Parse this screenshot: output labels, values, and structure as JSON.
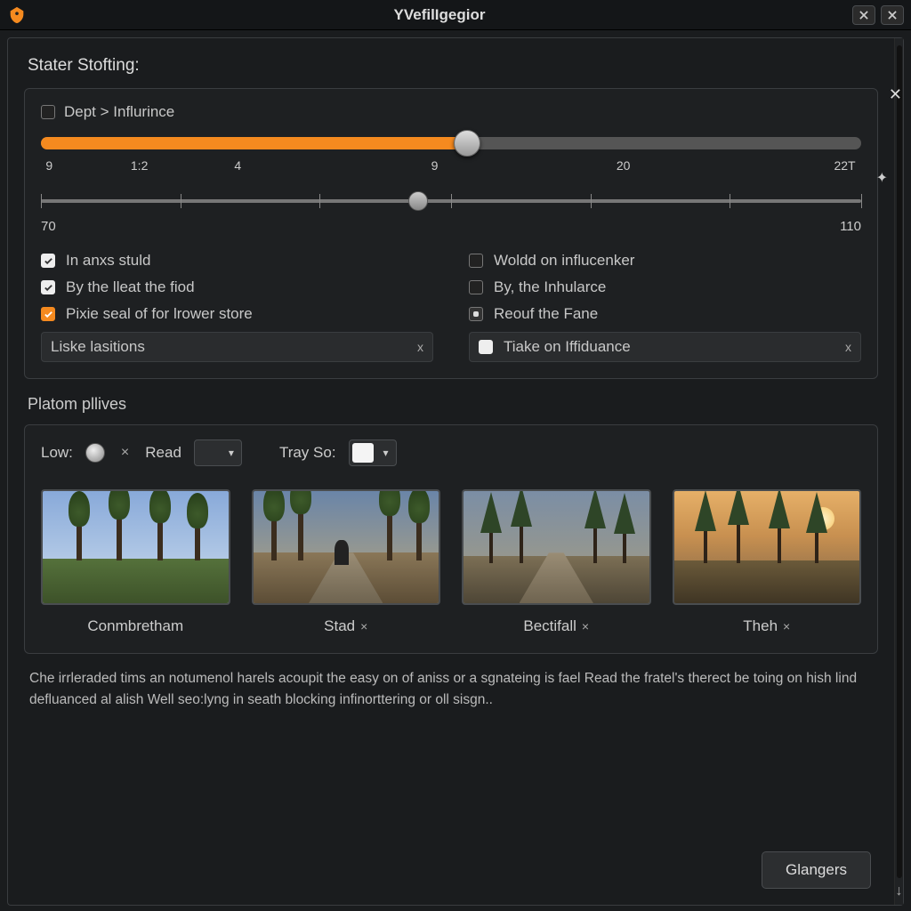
{
  "window": {
    "title": "YVefilIgegior"
  },
  "section1": {
    "heading": "Stater Stofting:",
    "dept_label": "Dept > Influrince",
    "slider1": {
      "fill_pct": 52,
      "ticks": [
        "9",
        "1:2",
        "4",
        "9",
        "20",
        "22T"
      ]
    },
    "slider2": {
      "min": "70",
      "max": "110",
      "thumb_pct": 46,
      "ticks_pct": [
        0,
        17,
        34,
        50,
        67,
        84,
        100
      ]
    },
    "checks_left": [
      {
        "label": "In anxs stuld",
        "state": "on"
      },
      {
        "label": "By the lleat the fiod",
        "state": "on"
      },
      {
        "label": "Pixie seal of for lrower store",
        "state": "accent"
      }
    ],
    "boxed_left": {
      "label": "Liske lasitions",
      "x": "x"
    },
    "checks_right": [
      {
        "label": "Woldd on influcenker",
        "state": "off"
      },
      {
        "label": "By, the Inhularce",
        "state": "off"
      },
      {
        "label": "Reouf the Fane",
        "state": "dot"
      }
    ],
    "boxed_right": {
      "label": "Tiake on Iffiduance",
      "x": "x",
      "state": "white"
    }
  },
  "section2": {
    "heading": "Platom pllives",
    "low_label": "Low:",
    "read_label": "Read",
    "tray_label": "Tray So:",
    "swatch1": "#1a1a1a",
    "swatch2": "#f4f4f4",
    "thumbs": [
      {
        "label": "Conmbretham",
        "x": ""
      },
      {
        "label": "Stad",
        "x": "×"
      },
      {
        "label": "Bectifall",
        "x": "×"
      },
      {
        "label": "Theh",
        "x": "×"
      }
    ]
  },
  "description": "Che irrleraded tims an notumenol harels acoupit the easy on of aniss or a sgnateing is fael Read the fratel's therect be toing on hish lind defluanced al alish Well seo:lyng in seath blocking infinorttering or oll sisgn..",
  "footer": {
    "button": "Glangers"
  }
}
